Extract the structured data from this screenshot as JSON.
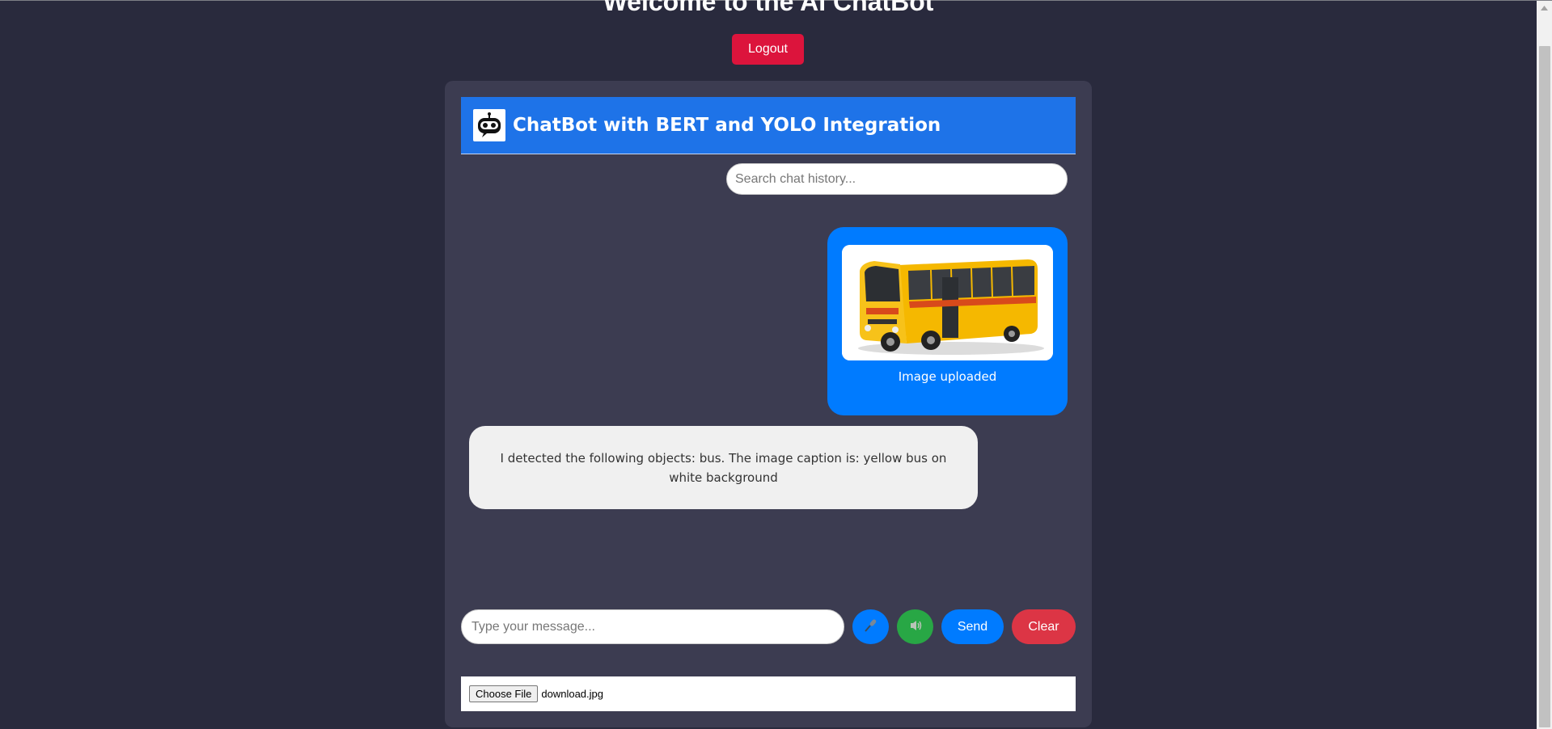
{
  "page": {
    "welcome_title": "Welcome to the AI ChatBot",
    "logout_label": "Logout"
  },
  "chat": {
    "header_title": "ChatBot with BERT and YOLO Integration",
    "search_placeholder": "Search chat history...",
    "messages": [
      {
        "sender": "user",
        "text": "Image uploaded",
        "has_image": true
      },
      {
        "sender": "bot",
        "text": "I detected the following objects: bus. The image caption is: yellow bus on white background"
      }
    ]
  },
  "input": {
    "message_placeholder": "Type your message...",
    "mic_icon": "microphone-icon",
    "speaker_icon": "speaker-icon",
    "send_label": "Send",
    "clear_label": "Clear"
  },
  "file": {
    "choose_label": "Choose File",
    "file_name": "download.jpg"
  },
  "colors": {
    "background": "#292a3d",
    "container": "#3c3c51",
    "header": "#1e73e8",
    "user_bubble": "#007bff",
    "bot_bubble": "#f0f0f0",
    "logout": "#dc143c",
    "clear": "#dc3545",
    "speaker": "#28a745"
  }
}
